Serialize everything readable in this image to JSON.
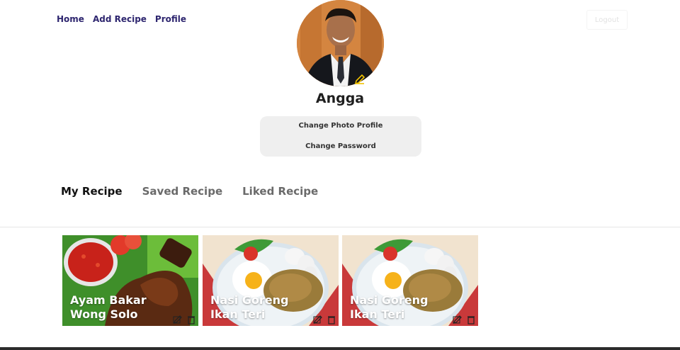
{
  "nav": {
    "home": "Home",
    "add_recipe": "Add Recipe",
    "profile": "Profile"
  },
  "header": {
    "logout": "Logout"
  },
  "profile": {
    "name": "Angga"
  },
  "menu": {
    "change_photo": "Change Photo Profile",
    "change_password": "Change Password"
  },
  "tabs": [
    {
      "label": "My Recipe",
      "active": true
    },
    {
      "label": "Saved Recipe",
      "active": false
    },
    {
      "label": "Liked Recipe",
      "active": false
    }
  ],
  "recipes": [
    {
      "title_line1": "Ayam Bakar",
      "title_line2": "Wong Solo"
    },
    {
      "title_line1": "Nasi Goreng",
      "title_line2": "Ikan Teri"
    },
    {
      "title_line1": "Nasi Goreng",
      "title_line2": "Ikan Teri"
    }
  ],
  "icons": {
    "edit": "edit-icon",
    "delete": "trash-icon",
    "avatar_edit": "pencil-icon"
  },
  "colors": {
    "nav_text": "#2e266f",
    "menu_bg": "#efefef",
    "pencil": "#f2c200"
  }
}
